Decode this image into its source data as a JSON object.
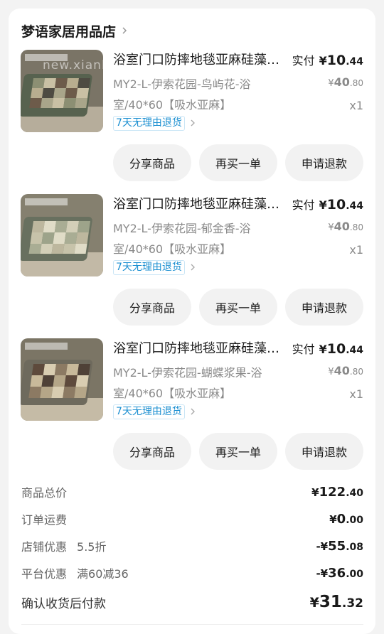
{
  "store": {
    "name": "梦语家居用品店"
  },
  "watermark": "new.xianbao.fun",
  "items": [
    {
      "title": "浴室门口防摔地毯亚麻硅藻泥吸水脚垫",
      "spec": "MY2-L-伊索花园-鸟屿花-浴室/40*60【吸水亚麻】",
      "paid_label": "实付",
      "paid": {
        "currency": "¥",
        "int": "10",
        "dec": ".44"
      },
      "orig": {
        "currency": "¥",
        "int": "40",
        "dec": ".80"
      },
      "qty": "x1",
      "tag": "7天无理由退货",
      "buttons": [
        "分享商品",
        "再买一单",
        "申请退款"
      ],
      "palette": {
        "bg": "#5e6b55",
        "tiles": [
          "#8c8f73",
          "#b8ad8f",
          "#6d5b4a",
          "#a9a58a",
          "#4e4b42",
          "#c9c0a4"
        ]
      }
    },
    {
      "title": "浴室门口防摔地毯亚麻硅藻泥吸水脚垫",
      "spec": "MY2-L-伊索花园-郁金香-浴室/40*60【吸水亚麻】",
      "paid_label": "实付",
      "paid": {
        "currency": "¥",
        "int": "10",
        "dec": ".44"
      },
      "orig": {
        "currency": "¥",
        "int": "40",
        "dec": ".80"
      },
      "qty": "x1",
      "tag": "7天无理由退货",
      "buttons": [
        "分享商品",
        "再买一单",
        "申请退款"
      ],
      "palette": {
        "bg": "#68705f",
        "tiles": [
          "#bdb79e",
          "#d3cfb8",
          "#a9ad94",
          "#c7c3aa",
          "#9da38a",
          "#e0dcc7"
        ]
      }
    },
    {
      "title": "浴室门口防摔地毯亚麻硅藻泥吸水脚垫",
      "spec": "MY2-L-伊索花园-蝴蝶浆果-浴室/40*60【吸水亚麻】",
      "paid_label": "实付",
      "paid": {
        "currency": "¥",
        "int": "10",
        "dec": ".44"
      },
      "orig": {
        "currency": "¥",
        "int": "40",
        "dec": ".80"
      },
      "qty": "x1",
      "tag": "7天无理由退货",
      "buttons": [
        "分享商品",
        "再买一单",
        "申请退款"
      ],
      "palette": {
        "bg": "#6e6a5d",
        "tiles": [
          "#5e4a3c",
          "#c8b99a",
          "#8c7a63",
          "#d9cdb1",
          "#4f4137",
          "#b5a688"
        ]
      }
    }
  ],
  "summary": {
    "goods_total": {
      "label": "商品总价",
      "currency": "¥",
      "int": "122",
      "dec": ".40"
    },
    "shipping": {
      "label": "订单运费",
      "currency": "¥",
      "int": "0",
      "dec": ".00"
    },
    "store_discount": {
      "label": "店铺优惠",
      "note": "5.5折",
      "currency": "-¥",
      "int": "55",
      "dec": ".08"
    },
    "platform_discount": {
      "label": "平台优惠",
      "note": "满60减36",
      "currency": "-¥",
      "int": "36",
      "dec": ".00"
    },
    "pay_on_receipt": {
      "label": "确认收货后付款",
      "currency": "¥",
      "int": "31",
      "dec": ".32"
    }
  },
  "colors": {
    "tag_blue": "#1b8fd1",
    "button_bg": "#f2f2f2",
    "muted_text": "#8a8a8a"
  }
}
